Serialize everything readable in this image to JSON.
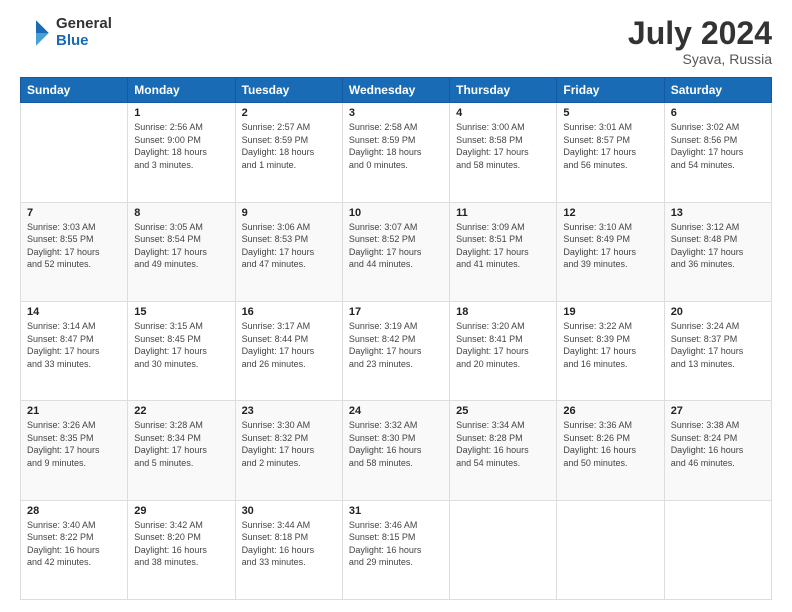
{
  "header": {
    "logo_line1": "General",
    "logo_line2": "Blue",
    "title": "July 2024",
    "subtitle": "Syava, Russia"
  },
  "days_of_week": [
    "Sunday",
    "Monday",
    "Tuesday",
    "Wednesday",
    "Thursday",
    "Friday",
    "Saturday"
  ],
  "weeks": [
    [
      {
        "day": "",
        "info": ""
      },
      {
        "day": "1",
        "info": "Sunrise: 2:56 AM\nSunset: 9:00 PM\nDaylight: 18 hours\nand 3 minutes."
      },
      {
        "day": "2",
        "info": "Sunrise: 2:57 AM\nSunset: 8:59 PM\nDaylight: 18 hours\nand 1 minute."
      },
      {
        "day": "3",
        "info": "Sunrise: 2:58 AM\nSunset: 8:59 PM\nDaylight: 18 hours\nand 0 minutes."
      },
      {
        "day": "4",
        "info": "Sunrise: 3:00 AM\nSunset: 8:58 PM\nDaylight: 17 hours\nand 58 minutes."
      },
      {
        "day": "5",
        "info": "Sunrise: 3:01 AM\nSunset: 8:57 PM\nDaylight: 17 hours\nand 56 minutes."
      },
      {
        "day": "6",
        "info": "Sunrise: 3:02 AM\nSunset: 8:56 PM\nDaylight: 17 hours\nand 54 minutes."
      }
    ],
    [
      {
        "day": "7",
        "info": "Sunrise: 3:03 AM\nSunset: 8:55 PM\nDaylight: 17 hours\nand 52 minutes."
      },
      {
        "day": "8",
        "info": "Sunrise: 3:05 AM\nSunset: 8:54 PM\nDaylight: 17 hours\nand 49 minutes."
      },
      {
        "day": "9",
        "info": "Sunrise: 3:06 AM\nSunset: 8:53 PM\nDaylight: 17 hours\nand 47 minutes."
      },
      {
        "day": "10",
        "info": "Sunrise: 3:07 AM\nSunset: 8:52 PM\nDaylight: 17 hours\nand 44 minutes."
      },
      {
        "day": "11",
        "info": "Sunrise: 3:09 AM\nSunset: 8:51 PM\nDaylight: 17 hours\nand 41 minutes."
      },
      {
        "day": "12",
        "info": "Sunrise: 3:10 AM\nSunset: 8:49 PM\nDaylight: 17 hours\nand 39 minutes."
      },
      {
        "day": "13",
        "info": "Sunrise: 3:12 AM\nSunset: 8:48 PM\nDaylight: 17 hours\nand 36 minutes."
      }
    ],
    [
      {
        "day": "14",
        "info": "Sunrise: 3:14 AM\nSunset: 8:47 PM\nDaylight: 17 hours\nand 33 minutes."
      },
      {
        "day": "15",
        "info": "Sunrise: 3:15 AM\nSunset: 8:45 PM\nDaylight: 17 hours\nand 30 minutes."
      },
      {
        "day": "16",
        "info": "Sunrise: 3:17 AM\nSunset: 8:44 PM\nDaylight: 17 hours\nand 26 minutes."
      },
      {
        "day": "17",
        "info": "Sunrise: 3:19 AM\nSunset: 8:42 PM\nDaylight: 17 hours\nand 23 minutes."
      },
      {
        "day": "18",
        "info": "Sunrise: 3:20 AM\nSunset: 8:41 PM\nDaylight: 17 hours\nand 20 minutes."
      },
      {
        "day": "19",
        "info": "Sunrise: 3:22 AM\nSunset: 8:39 PM\nDaylight: 17 hours\nand 16 minutes."
      },
      {
        "day": "20",
        "info": "Sunrise: 3:24 AM\nSunset: 8:37 PM\nDaylight: 17 hours\nand 13 minutes."
      }
    ],
    [
      {
        "day": "21",
        "info": "Sunrise: 3:26 AM\nSunset: 8:35 PM\nDaylight: 17 hours\nand 9 minutes."
      },
      {
        "day": "22",
        "info": "Sunrise: 3:28 AM\nSunset: 8:34 PM\nDaylight: 17 hours\nand 5 minutes."
      },
      {
        "day": "23",
        "info": "Sunrise: 3:30 AM\nSunset: 8:32 PM\nDaylight: 17 hours\nand 2 minutes."
      },
      {
        "day": "24",
        "info": "Sunrise: 3:32 AM\nSunset: 8:30 PM\nDaylight: 16 hours\nand 58 minutes."
      },
      {
        "day": "25",
        "info": "Sunrise: 3:34 AM\nSunset: 8:28 PM\nDaylight: 16 hours\nand 54 minutes."
      },
      {
        "day": "26",
        "info": "Sunrise: 3:36 AM\nSunset: 8:26 PM\nDaylight: 16 hours\nand 50 minutes."
      },
      {
        "day": "27",
        "info": "Sunrise: 3:38 AM\nSunset: 8:24 PM\nDaylight: 16 hours\nand 46 minutes."
      }
    ],
    [
      {
        "day": "28",
        "info": "Sunrise: 3:40 AM\nSunset: 8:22 PM\nDaylight: 16 hours\nand 42 minutes."
      },
      {
        "day": "29",
        "info": "Sunrise: 3:42 AM\nSunset: 8:20 PM\nDaylight: 16 hours\nand 38 minutes."
      },
      {
        "day": "30",
        "info": "Sunrise: 3:44 AM\nSunset: 8:18 PM\nDaylight: 16 hours\nand 33 minutes."
      },
      {
        "day": "31",
        "info": "Sunrise: 3:46 AM\nSunset: 8:15 PM\nDaylight: 16 hours\nand 29 minutes."
      },
      {
        "day": "",
        "info": ""
      },
      {
        "day": "",
        "info": ""
      },
      {
        "day": "",
        "info": ""
      }
    ]
  ]
}
